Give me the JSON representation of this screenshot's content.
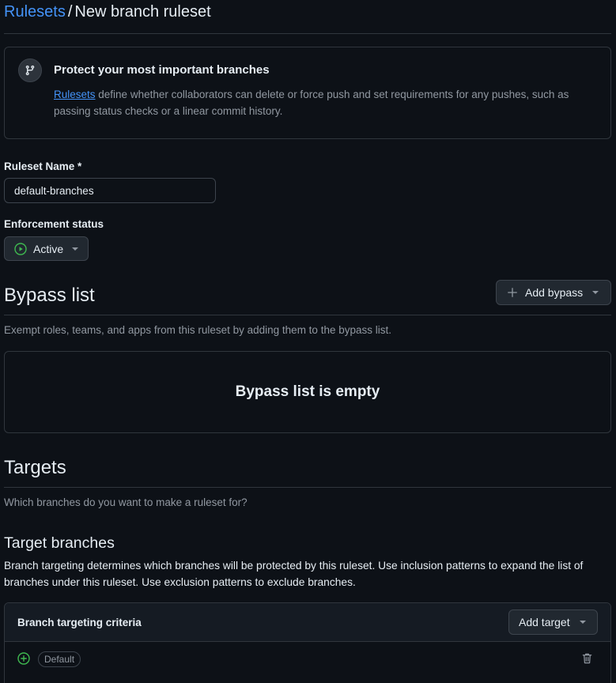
{
  "breadcrumb": {
    "parent_label": "Rulesets",
    "separator": "/",
    "current_label": "New branch ruleset"
  },
  "banner": {
    "title": "Protect your most important branches",
    "link_text": "Rulesets",
    "description": " define whether collaborators can delete or force push and set requirements for any pushes, such as passing status checks or a linear commit history."
  },
  "form": {
    "name_label": "Ruleset Name *",
    "name_value": "default-branches",
    "enforcement_label": "Enforcement status",
    "enforcement_value": "Active"
  },
  "bypass": {
    "title": "Bypass list",
    "add_button_label": "Add bypass",
    "description": "Exempt roles, teams, and apps from this ruleset by adding them to the bypass list.",
    "empty_text": "Bypass list is empty"
  },
  "targets": {
    "title": "Targets",
    "description": "Which branches do you want to make a ruleset for?",
    "target_branches_title": "Target branches",
    "target_branches_description": "Branch targeting determines which branches will be protected by this ruleset. Use inclusion patterns to expand the list of branches under this ruleset. Use exclusion patterns to exclude branches.",
    "criteria_title": "Branch targeting criteria",
    "add_target_label": "Add target",
    "criteria_items": [
      {
        "icon": "plus-circle-icon",
        "badge": "Default"
      }
    ]
  },
  "colors": {
    "background": "#0d1117",
    "link": "#4493f8",
    "active_green": "#3fb950",
    "border": "#30363d"
  }
}
